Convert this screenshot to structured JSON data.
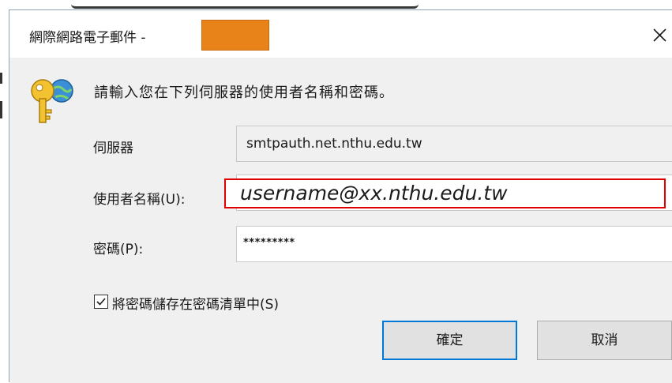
{
  "dialog": {
    "title": "網際網路電子郵件 -",
    "close_glyph": "×",
    "prompt": "請輸入您在下列伺服器的使用者名稱和密碼。",
    "fields": {
      "server_label": "伺服器",
      "server_value": "smtpauth.net.nthu.edu.tw",
      "username_label": "使用者名稱(U):",
      "username_value": "username@xx.nthu.edu.tw",
      "password_label": "密碼(P):",
      "password_value": "*********"
    },
    "remember_password": {
      "label": "將密碼儲存在密碼清單中(S)",
      "checked": true
    },
    "buttons": {
      "ok_label": "確定",
      "cancel_label": "取消"
    }
  },
  "colors": {
    "redaction": "#e8831a",
    "highlight_border": "#e00000",
    "primary_button_border": "#0078d7",
    "dialog_background": "#f0f0f0"
  },
  "icons": {
    "dialog_icon": "key-icon",
    "close": "close-icon",
    "checkbox": "checkmark-icon"
  }
}
